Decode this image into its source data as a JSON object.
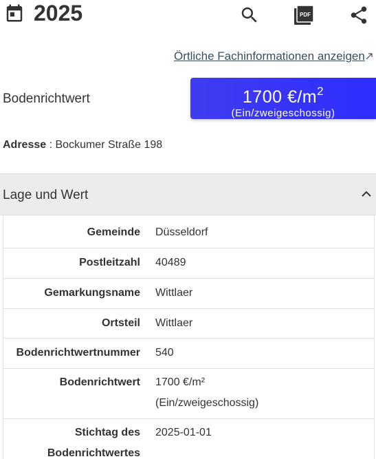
{
  "header": {
    "year": "2025",
    "icons": {
      "calendar": "calendar-icon",
      "search": "search-icon",
      "pdf": "pdf-icon",
      "share": "share-icon"
    },
    "pdf_badge": "PDF"
  },
  "fach_link": "Örtliche Fachinformationen anzeigen",
  "bodenrichtwert": {
    "label": "Bodenrichtwert",
    "value": "1700 €/m",
    "exponent": "2",
    "sub": "(Ein/zweigeschossig)",
    "accent": "#3330ff"
  },
  "address": {
    "label": "Adresse",
    "separator": " : ",
    "value": "Bockumer Straße 198"
  },
  "section": {
    "title": "Lage und Wert",
    "state": "expanded"
  },
  "table": [
    {
      "key": "Gemeinde",
      "value": "Düsseldorf"
    },
    {
      "key": "Postleitzahl",
      "value": "40489"
    },
    {
      "key": "Gemarkungsname",
      "value": "Wittlaer"
    },
    {
      "key": "Ortsteil",
      "value": "Wittlaer"
    },
    {
      "key": "Bodenrichtwertnummer",
      "value": "540"
    },
    {
      "key": "Bodenrichtwert",
      "value": "1700 €/m²",
      "value2": "(Ein/zweigeschossig)"
    },
    {
      "key": "Stichtag des",
      "key2": "Bodenrichtwertes",
      "value": "2025-01-01"
    }
  ]
}
